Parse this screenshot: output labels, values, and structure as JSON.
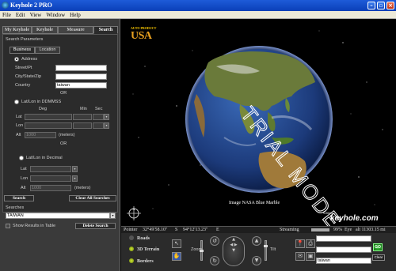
{
  "window": {
    "title": "Keyhole 2 PRO"
  },
  "menu": [
    "File",
    "Edit",
    "View",
    "Window",
    "Help"
  ],
  "sidebar": {
    "tabs": [
      "My Keyhole",
      "Keyhole",
      "Measure",
      "Search"
    ],
    "active_tab": "Search",
    "section_title": "Search Parameters",
    "subtabs": [
      "Business",
      "Location"
    ],
    "address": {
      "label": "Address",
      "street_label": "Street/Pt",
      "city_label": "City/State/Zip",
      "country_label": "Country",
      "country_value": "taiwan",
      "or": "OR"
    },
    "dms": {
      "label": "Lat/Lon in DDMMSS",
      "deg": "Deg",
      "min": "Min",
      "sec": "Sec",
      "lat": "Lat",
      "lon": "Lon",
      "alt": "Alt",
      "alt_value": "1000",
      "meters": "(meters)",
      "or": "OR"
    },
    "decimal": {
      "label": "Lat/Lon in Decimal",
      "lat": "Lat",
      "lon": "Lon",
      "alt": "Alt",
      "alt_value": "1000",
      "meters": "(meters)"
    },
    "search_button": "Search",
    "clear_all_button": "Clear All Searches",
    "searches_label": "Searches",
    "searches_selected": "TAIWAN",
    "show_results_label": "Show Results in Table",
    "delete_button": "Delete Search"
  },
  "globe": {
    "brand_small": "AUTO PRODUCT",
    "brand_big": "USA",
    "watermark": "TRIAL MODE",
    "caption": "Image NASA Blue Marble",
    "copyright": "©2004",
    "logo": "keyhole.com"
  },
  "status": {
    "pointer_label": "Pointer",
    "lat": "32°49'58.10\"",
    "lat_hemi": "S",
    "lon": "94°12'13.23\"",
    "lon_hemi": "E",
    "streaming_label": "Streaming",
    "streaming_value": "99%",
    "streaming_fraction": 0.99,
    "eye_label": "Eye",
    "eye_alt": "alt 11303.15 mi"
  },
  "controls": {
    "layers": [
      {
        "label": "Roads",
        "on": false
      },
      {
        "label": "3D Terrain",
        "on": true
      },
      {
        "label": "Borders",
        "on": true
      }
    ],
    "zoom_label": "Zoom",
    "tilt_label": "Tilt",
    "go_label": "GO",
    "clear_label": "Clear",
    "search_value": "taiwan"
  }
}
